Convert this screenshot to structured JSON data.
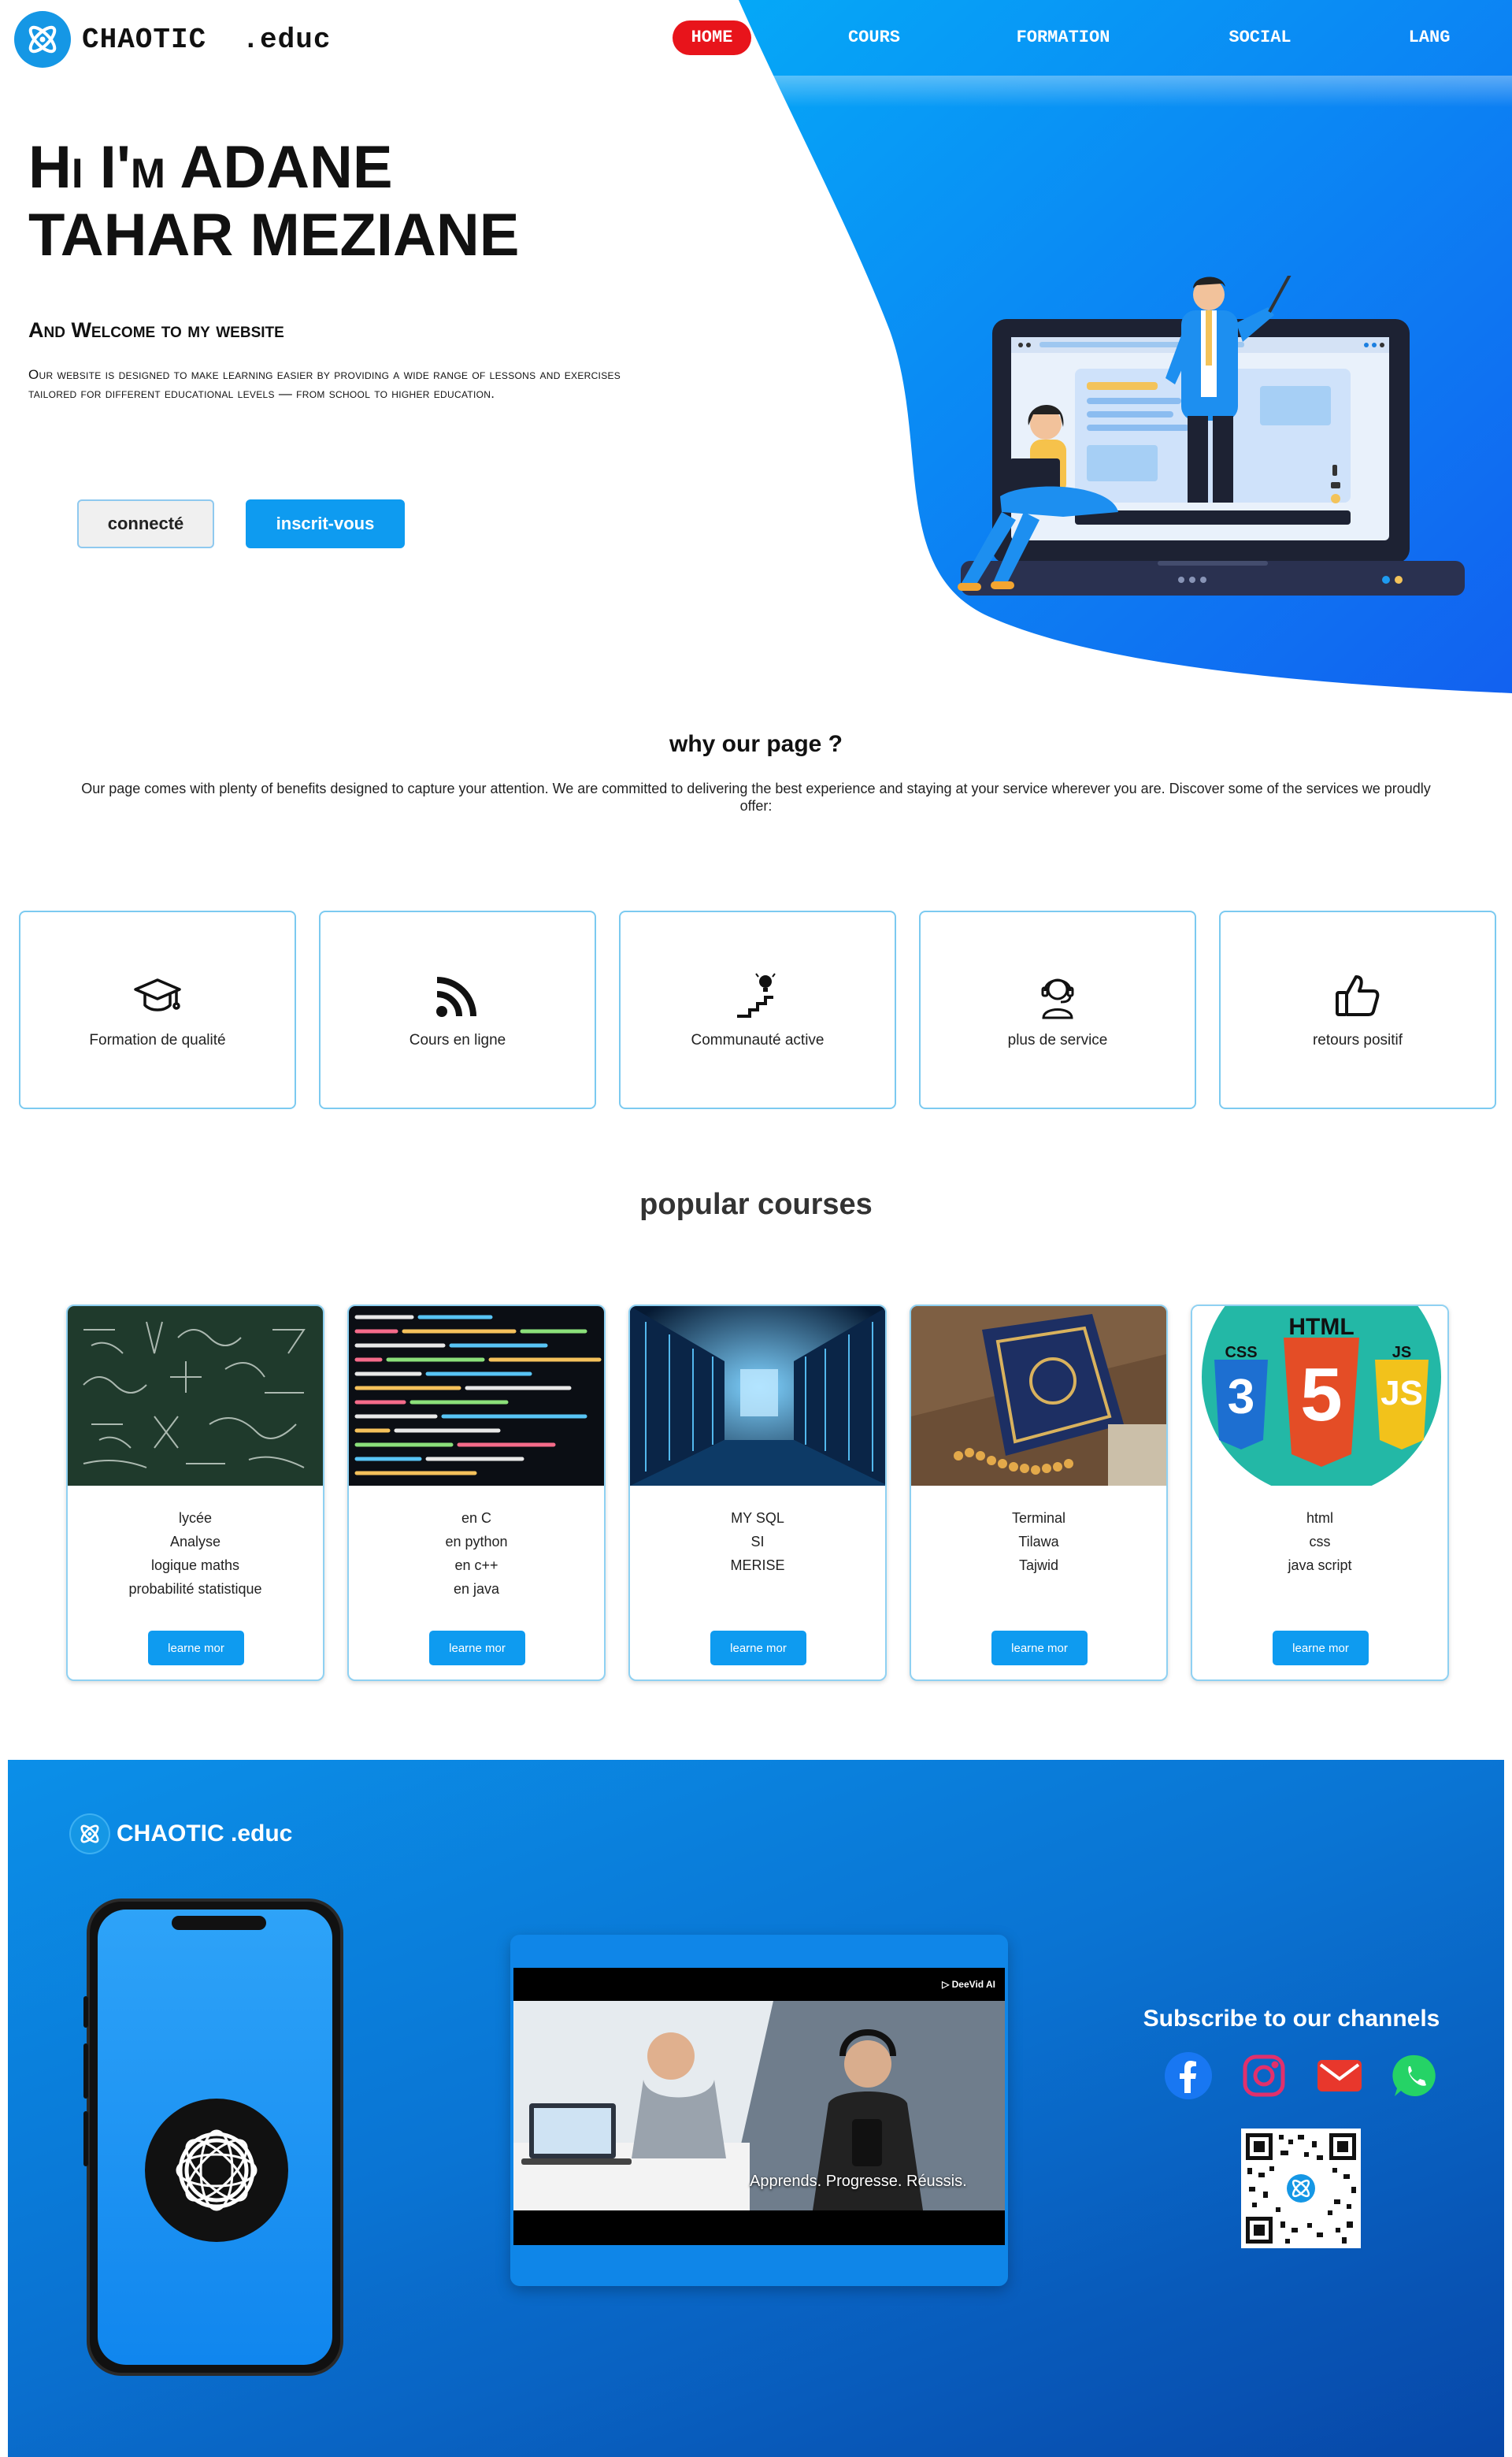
{
  "brand": {
    "name": "CHAOTIC",
    "suffix": ".educ",
    "footer_name": "CHAOTIC",
    "footer_suffix": ".educ"
  },
  "nav": {
    "home": "HOME",
    "cours": "COURS",
    "formation": "FORMATION",
    "social": "SOCIAL",
    "lang": "LANG"
  },
  "hero": {
    "title_line1": "Hi I'm ADANE",
    "title_line2": "TAHAR MEZIANE",
    "subtitle": "And Welcome to my website",
    "description": "Our website is designed to make learning easier by providing a wide range of lessons and exercises tailored for different educational levels — from school to higher education.",
    "login_button": "connecté",
    "signup_button": "inscrit-vous"
  },
  "why": {
    "title": "why our page ?",
    "text": "Our page comes with plenty of benefits designed to capture your attention. We are committed to delivering the best experience and staying at your service wherever you are. Discover some of the services we proudly offer:"
  },
  "features": [
    {
      "label": "Formation de qualité",
      "icon": "graduation-cap-icon"
    },
    {
      "label": "Cours en ligne",
      "icon": "rss-feed-icon"
    },
    {
      "label": "Communauté active",
      "icon": "lightbulb-stairs-icon"
    },
    {
      "label": "plus de service",
      "icon": "headset-support-icon"
    },
    {
      "label": "retours positif",
      "icon": "thumbs-up-icon"
    }
  ],
  "courses_title": "popular courses",
  "courses": [
    {
      "lines": [
        "lycée",
        "Analyse",
        "logique maths",
        "probabilité statistique"
      ],
      "button": "learne mor"
    },
    {
      "lines": [
        "en C",
        "en python",
        "en c++",
        "en java"
      ],
      "button": "learne mor"
    },
    {
      "lines": [
        "MY SQL",
        "SI",
        "MERISE"
      ],
      "button": "learne mor"
    },
    {
      "lines": [
        "Terminal",
        "Tilawa",
        "Tajwid"
      ],
      "button": "learne mor"
    },
    {
      "lines": [
        "html",
        "css",
        "java script"
      ],
      "button": "learne mor"
    }
  ],
  "course_image_text": {
    "html_word": "HTML",
    "css_word": "CSS",
    "js_word": "JS",
    "css_num": "3",
    "html_num": "5",
    "js_num": "JS"
  },
  "footer": {
    "subscribe": "Subscribe to our channels",
    "video_tag": "DeeVid AI",
    "video_caption": "Apprends. Progresse. Réussis.",
    "socials": [
      "facebook-icon",
      "instagram-icon",
      "mail-icon",
      "whatsapp-icon"
    ]
  },
  "colors": {
    "accent": "#0e9bf0",
    "nav_active": "#e8141b",
    "footer_dark": "#0747a8"
  }
}
